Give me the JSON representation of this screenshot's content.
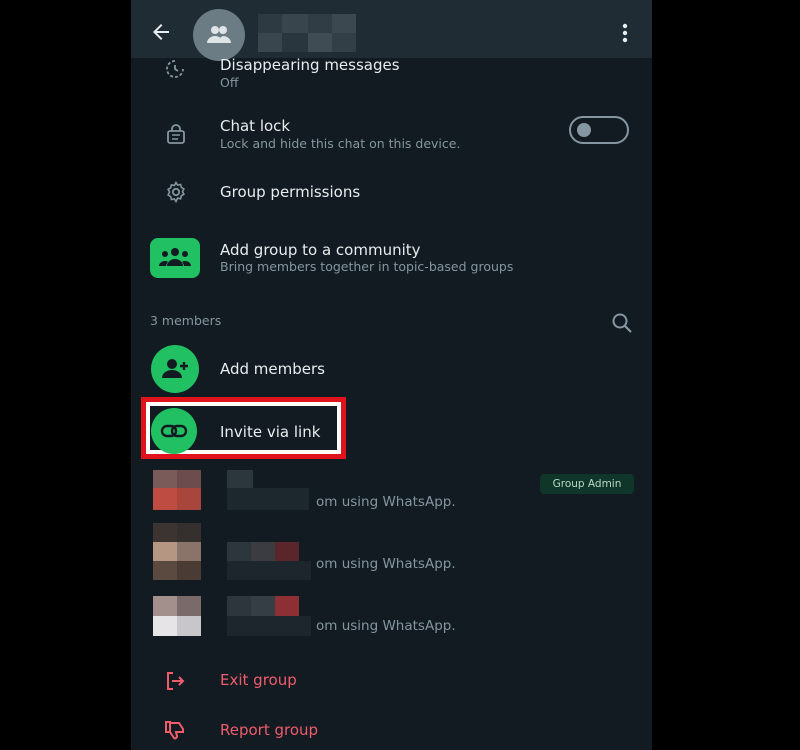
{
  "header": {
    "back_icon": "arrow-left-icon",
    "avatar_icon": "group-icon",
    "menu_icon": "more-vert-icon"
  },
  "settings": {
    "disappearing": {
      "title": "Disappearing messages",
      "subtitle": "Off",
      "icon": "timer-icon"
    },
    "chat_lock": {
      "title": "Chat lock",
      "subtitle": "Lock and hide this chat on this device.",
      "icon": "chat-lock-icon",
      "toggle_on": false
    },
    "group_permissions": {
      "title": "Group permissions",
      "icon": "gear-icon"
    },
    "community": {
      "title": "Add group to a community",
      "subtitle": "Bring members together in topic-based groups",
      "icon": "community-icon"
    }
  },
  "members": {
    "count_label": "3 members",
    "add_label": "Add members",
    "invite_label": "Invite via link",
    "list": [
      {
        "status": "om using WhatsApp.",
        "badge": "Group Admin"
      },
      {
        "status": "om using WhatsApp."
      },
      {
        "status": "om using WhatsApp."
      }
    ]
  },
  "actions": {
    "exit_label": "Exit group",
    "report_label": "Report group"
  },
  "colors": {
    "background": "#111b21",
    "accent_green": "#21c063",
    "danger_red": "#f15c6d",
    "annotation_red": "#e0131c"
  }
}
